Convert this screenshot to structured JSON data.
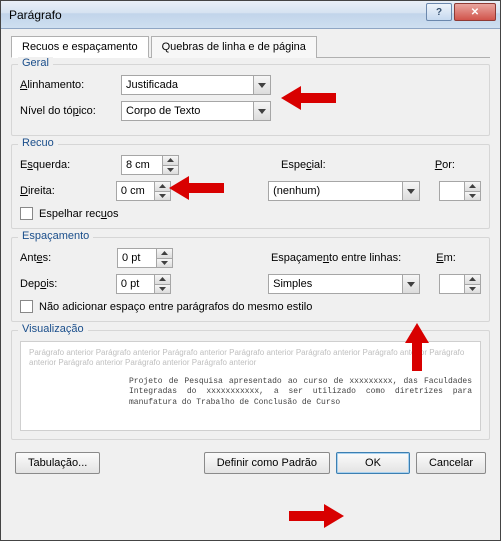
{
  "window": {
    "title": "Parágrafo",
    "help": "?",
    "close": "✕"
  },
  "tabs": {
    "active": "Recuos e espaçamento",
    "inactive": "Quebras de linha e de página"
  },
  "general": {
    "legend": "Geral",
    "alignment_label": "Alinhamento:",
    "alignment_value": "Justificada",
    "outline_label": "Nível do tópico:",
    "outline_value": "Corpo de Texto"
  },
  "indent": {
    "legend": "Recuo",
    "left_label": "Esquerda:",
    "left_value": "8 cm",
    "right_label": "Direita:",
    "right_value": "0 cm",
    "special_label": "Especial:",
    "special_value": "(nenhum)",
    "by_label": "Por:",
    "by_value": "",
    "mirror_label": "Espelhar recuos"
  },
  "spacing": {
    "legend": "Espaçamento",
    "before_label": "Antes:",
    "before_value": "0 pt",
    "after_label": "Depois:",
    "after_value": "0 pt",
    "line_label": "Espaçamento entre linhas:",
    "line_value": "Simples",
    "at_label": "Em:",
    "at_value": "",
    "dontadd_label": "Não adicionar espaço entre parágrafos do mesmo estilo"
  },
  "preview": {
    "legend": "Visualização",
    "lorem": "Parágrafo anterior Parágrafo anterior Parágrafo anterior Parágrafo anterior Parágrafo anterior Parágrafo anterior Parágrafo anterior Parágrafo anterior Parágrafo anterior Parágrafo anterior",
    "sample": "Projeto de Pesquisa apresentado ao curso de xxxxxxxxx, das Faculdades Integradas do xxxxxxxxxxx, a ser utilizado como diretrizes para manufatura do Trabalho de Conclusão de Curso"
  },
  "buttons": {
    "tabs": "Tabulação...",
    "default": "Definir como Padrão",
    "ok": "OK",
    "cancel": "Cancelar"
  }
}
